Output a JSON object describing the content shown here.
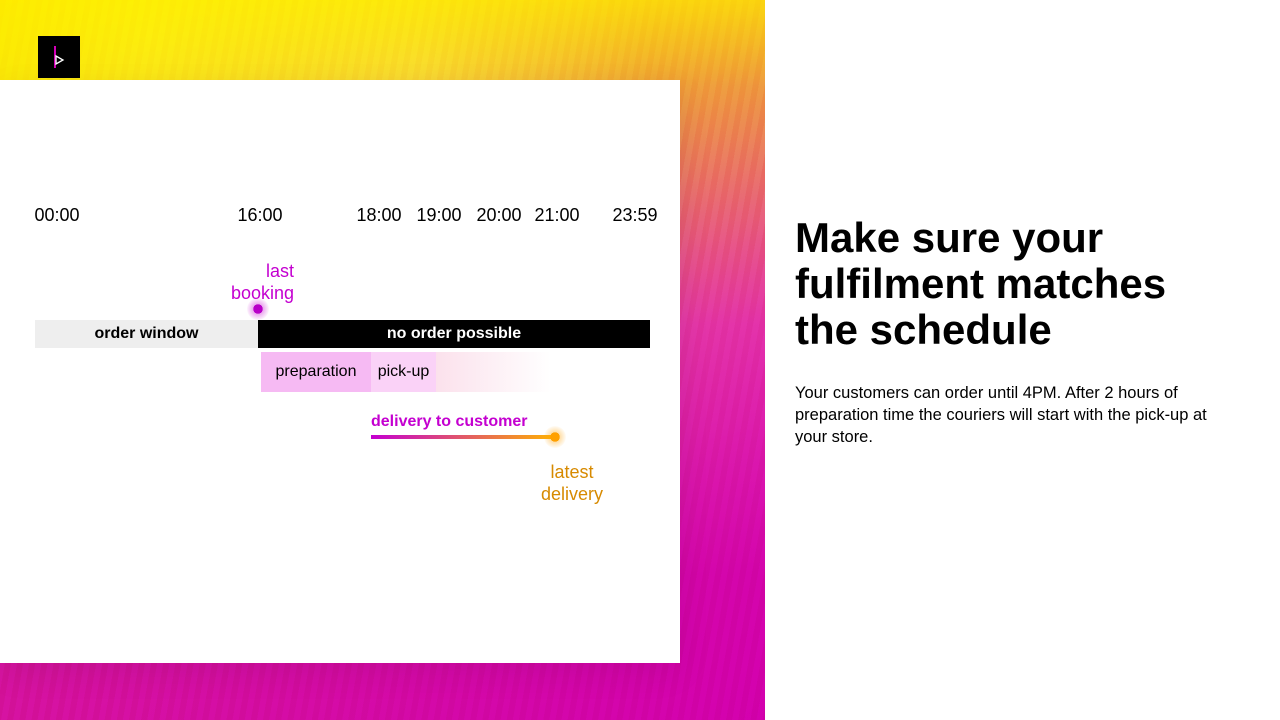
{
  "timeline": {
    "ticks": {
      "t0": "00:00",
      "t1": "16:00",
      "t2": "18:00",
      "t3": "19:00",
      "t4": "20:00",
      "t5": "21:00",
      "t6": "23:59"
    },
    "lastBooking1": "last",
    "lastBooking2": "booking",
    "orderWindow": "order window",
    "noOrder": "no order possible",
    "preparation": "preparation",
    "pickup": "pick-up",
    "deliveryLabel": "delivery to customer",
    "latest1": "latest",
    "latest2": "delivery"
  },
  "right": {
    "title": "Make sure your fulfilment matches the schedule",
    "body": "Your customers can order until 4PM. After 2 hours of preparation time the couriers will start with the pick-up at your store."
  },
  "chart_data": {
    "type": "gantt",
    "title": "Fulfilment schedule",
    "xaxis": {
      "unit": "time",
      "min": "00:00",
      "max": "23:59"
    },
    "segments": [
      {
        "name": "order window",
        "start": "00:00",
        "end": "16:00"
      },
      {
        "name": "no order possible",
        "start": "16:00",
        "end": "23:59"
      },
      {
        "name": "preparation",
        "start": "16:00",
        "end": "18:00"
      },
      {
        "name": "pick-up",
        "start": "18:00",
        "end": "19:00"
      },
      {
        "name": "delivery to customer",
        "start": "18:00",
        "end": "21:00"
      }
    ],
    "markers": [
      {
        "name": "last booking",
        "time": "16:00",
        "color": "#c400d0"
      },
      {
        "name": "latest delivery",
        "time": "21:00",
        "color": "#ffa000"
      }
    ]
  }
}
